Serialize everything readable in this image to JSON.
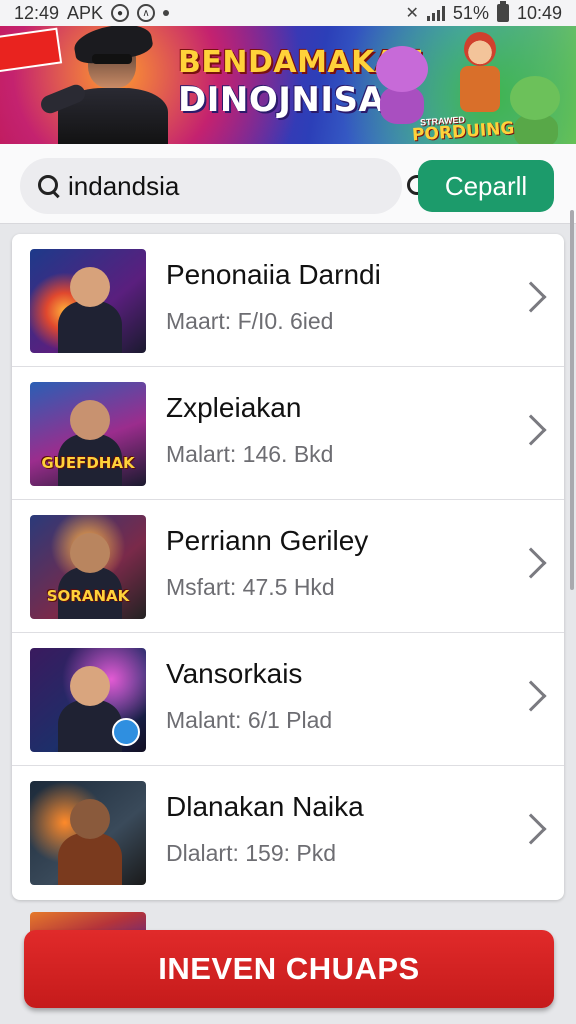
{
  "status_bar": {
    "time": "12:49",
    "app_label": "APK",
    "battery_percent": "51%",
    "clock_right": "10:49",
    "icons": [
      "camera-icon",
      "app-icon",
      "dot-icon",
      "mute-icon",
      "signal-icon",
      "battery-icon"
    ]
  },
  "banner": {
    "ribbon_text": "",
    "title_line1": "BENDAMAKAN",
    "title_line2": "DINOJNISA",
    "sub_small": "STRAWED",
    "sub_logo": "PORDUING"
  },
  "search": {
    "value": "indandsia",
    "button_label": "Ceparll"
  },
  "list": [
    {
      "name": "Penonaiia Darndi",
      "meta": "Maart: F/I0. 6ied",
      "caption": ""
    },
    {
      "name": "Zxpleiakan",
      "meta": "Malart: 146. Bkd",
      "caption": "GUEFDHAK"
    },
    {
      "name": "Perriann Geriley",
      "meta": "Msfart: 47.5 Hkd",
      "caption": "SORANAK"
    },
    {
      "name": "Vansorkais",
      "meta": "Malant: 6/1 Plad",
      "caption": ""
    },
    {
      "name": "Dlanakan Naika",
      "meta": "Dlalart: 159: Pkd",
      "caption": ""
    }
  ],
  "bottom_button": "INEVEN CHUAPS",
  "colors": {
    "accent_green": "#1c9b6b",
    "cta_red": "#d52222"
  }
}
